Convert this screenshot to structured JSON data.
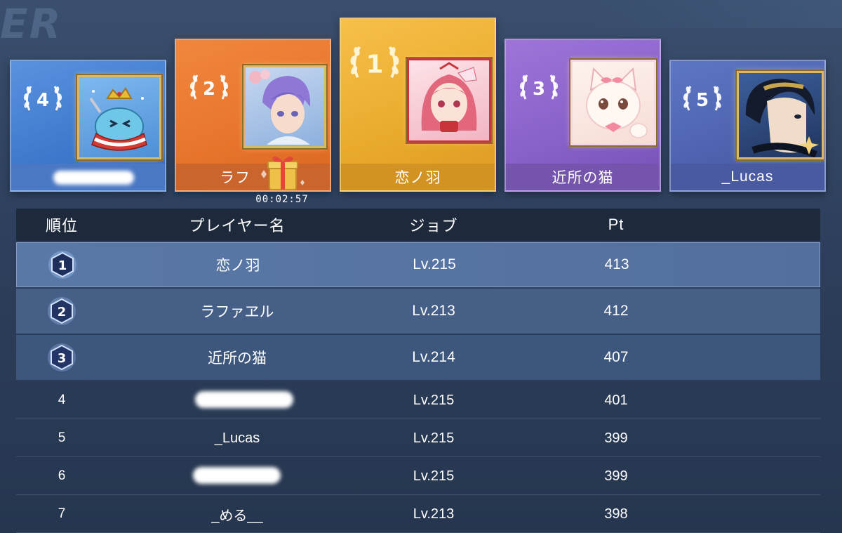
{
  "background_text": "ER",
  "podium": [
    {
      "rank": "4",
      "name": "",
      "color": "#4a7fd0"
    },
    {
      "rank": "2",
      "name": "ラフ",
      "color": "#ea782e"
    },
    {
      "rank": "1",
      "name": "恋ノ羽",
      "color": "#f0b43a"
    },
    {
      "rank": "3",
      "name": "近所の猫",
      "color": "#8a62c8"
    },
    {
      "rank": "5",
      "name": "_Lucas",
      "color": "#4e64b0"
    }
  ],
  "timer": "00:02:57",
  "table": {
    "headers": {
      "rank": "順位",
      "player": "プレイヤー名",
      "job": "ジョブ",
      "pt": "Pt"
    },
    "rows": [
      {
        "rank": "1",
        "name": "恋ノ羽",
        "job": "Lv.215",
        "pt": "413"
      },
      {
        "rank": "2",
        "name": "ラファヱル",
        "job": "Lv.213",
        "pt": "412"
      },
      {
        "rank": "3",
        "name": "近所の猫",
        "job": "Lv.214",
        "pt": "407"
      },
      {
        "rank": "4",
        "name": "",
        "job": "Lv.215",
        "pt": "401"
      },
      {
        "rank": "5",
        "name": "_Lucas",
        "job": "Lv.215",
        "pt": "399"
      },
      {
        "rank": "6",
        "name": "",
        "job": "Lv.215",
        "pt": "399"
      },
      {
        "rank": "7",
        "name": "_める__",
        "job": "Lv.213",
        "pt": "398"
      }
    ]
  }
}
